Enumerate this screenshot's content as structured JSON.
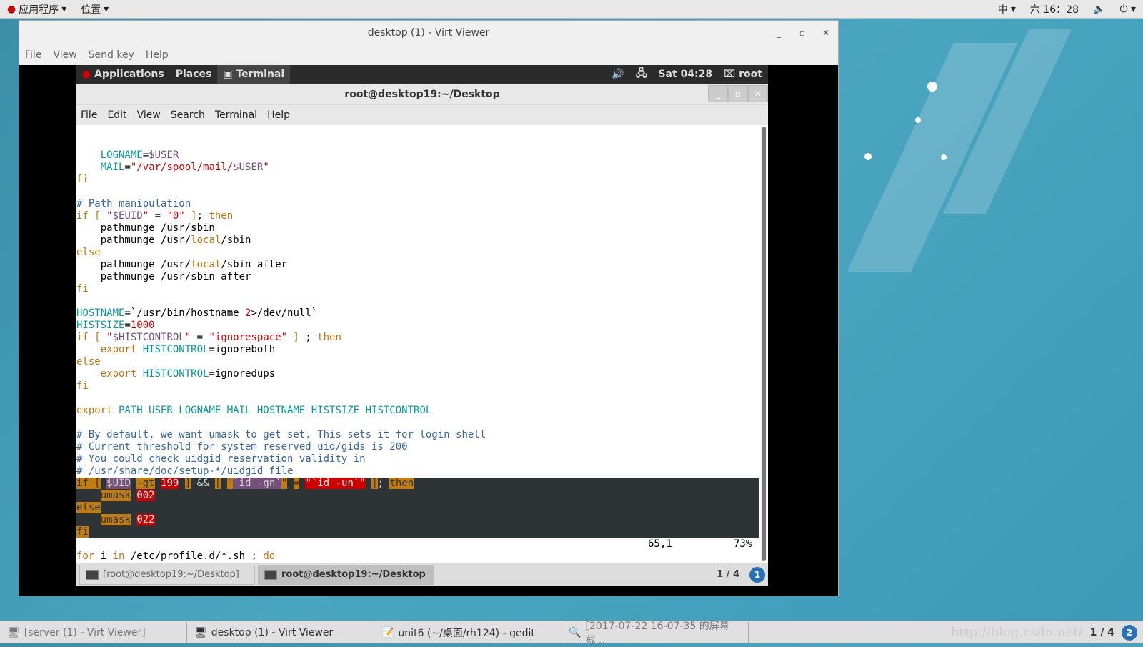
{
  "topbar": {
    "apps": "应用程序",
    "places": "位置",
    "input": "中",
    "clock": "六 16：28"
  },
  "viewer": {
    "title": "desktop (1) - Virt Viewer",
    "menu": [
      "File",
      "View",
      "Send key",
      "Help"
    ]
  },
  "guest_bar": {
    "applications": "Applications",
    "places": "Places",
    "terminal": "Terminal",
    "clock": "Sat 04:28",
    "user": "root"
  },
  "terminal": {
    "title": "root@desktop19:~/Desktop",
    "menu": [
      "File",
      "Edit",
      "View",
      "Search",
      "Terminal",
      "Help"
    ],
    "status_pos": "65,1",
    "status_pct": "73%",
    "lines": [
      {
        "s": [
          [
            "    ",
            ""
          ],
          [
            "LOGNAME",
            "c-cyan"
          ],
          [
            "=",
            ""
          ],
          [
            "$USER",
            "c-purple"
          ]
        ]
      },
      {
        "s": [
          [
            "    ",
            ""
          ],
          [
            "MAIL",
            "c-cyan"
          ],
          [
            "=",
            ""
          ],
          [
            "\"/var/spool/mail/",
            "c-red"
          ],
          [
            "$USER",
            "c-purple"
          ],
          [
            "\"",
            "c-red"
          ]
        ]
      },
      {
        "s": [
          [
            "fi",
            "c-orange"
          ]
        ]
      },
      {
        "s": []
      },
      {
        "s": [
          [
            "# Path manipulation",
            "c-blue"
          ]
        ]
      },
      {
        "s": [
          [
            "if [ ",
            "c-orange"
          ],
          [
            "\"",
            "c-red"
          ],
          [
            "$EUID",
            "c-purple"
          ],
          [
            "\"",
            "c-red"
          ],
          [
            " = ",
            ""
          ],
          [
            "\"0\"",
            "c-red"
          ],
          [
            " ]",
            "c-orange"
          ],
          [
            "; ",
            ""
          ],
          [
            "then",
            "c-orange"
          ]
        ]
      },
      {
        "s": [
          [
            "    pathmunge /usr/sbin",
            ""
          ]
        ]
      },
      {
        "s": [
          [
            "    pathmunge /usr/",
            ""
          ],
          [
            "local",
            "c-orange"
          ],
          [
            "/sbin",
            ""
          ]
        ]
      },
      {
        "s": [
          [
            "else",
            "c-orange"
          ]
        ]
      },
      {
        "s": [
          [
            "    pathmunge /usr/",
            ""
          ],
          [
            "local",
            "c-orange"
          ],
          [
            "/sbin after",
            ""
          ]
        ]
      },
      {
        "s": [
          [
            "    pathmunge /usr/sbin after",
            ""
          ]
        ]
      },
      {
        "s": [
          [
            "fi",
            "c-orange"
          ]
        ]
      },
      {
        "s": []
      },
      {
        "s": [
          [
            "HOSTNAME",
            "c-cyan"
          ],
          [
            "=`/usr/bin/hostname ",
            ""
          ],
          [
            "2",
            "c-red"
          ],
          [
            ">/dev/null`",
            ""
          ]
        ]
      },
      {
        "s": [
          [
            "HISTSIZE",
            "c-cyan"
          ],
          [
            "=",
            ""
          ],
          [
            "1000",
            "c-red"
          ]
        ]
      },
      {
        "s": [
          [
            "if [ ",
            "c-orange"
          ],
          [
            "\"",
            "c-red"
          ],
          [
            "$HISTCONTROL",
            "c-purple"
          ],
          [
            "\"",
            "c-red"
          ],
          [
            " = ",
            ""
          ],
          [
            "\"ignorespace\"",
            "c-red"
          ],
          [
            " ]",
            "c-orange"
          ],
          [
            " ; ",
            ""
          ],
          [
            "then",
            "c-orange"
          ]
        ]
      },
      {
        "s": [
          [
            "    ",
            ""
          ],
          [
            "export",
            "c-orange"
          ],
          [
            " ",
            ""
          ],
          [
            "HISTCONTROL",
            "c-cyan"
          ],
          [
            "=ignoreboth",
            ""
          ]
        ]
      },
      {
        "s": [
          [
            "else",
            "c-orange"
          ]
        ]
      },
      {
        "s": [
          [
            "    ",
            ""
          ],
          [
            "export",
            "c-orange"
          ],
          [
            " ",
            ""
          ],
          [
            "HISTCONTROL",
            "c-cyan"
          ],
          [
            "=ignoredups",
            ""
          ]
        ]
      },
      {
        "s": [
          [
            "fi",
            "c-orange"
          ]
        ]
      },
      {
        "s": []
      },
      {
        "s": [
          [
            "export",
            "c-orange"
          ],
          [
            " PATH USER LOGNAME MAIL HOSTNAME HISTSIZE HISTCONTROL",
            "c-cyan"
          ]
        ]
      },
      {
        "s": []
      },
      {
        "s": [
          [
            "# By default, we want umask to get set. This sets it for login shell",
            "c-blue"
          ]
        ]
      },
      {
        "s": [
          [
            "# Current threshold for system reserved uid/gids is 200",
            "c-blue"
          ]
        ]
      },
      {
        "s": [
          [
            "# You could check uidgid reservation validity in",
            "c-blue"
          ]
        ]
      },
      {
        "s": [
          [
            "# /usr/share/doc/setup-*/uidgid file",
            "c-blue"
          ]
        ]
      },
      {
        "hl": true,
        "s": [
          [
            "if [",
            "h-or"
          ],
          [
            " ",
            "h-plain"
          ],
          [
            "$UID",
            "h-pu"
          ],
          [
            " ",
            "h-plain"
          ],
          [
            "-gt",
            "h-or"
          ],
          [
            " ",
            "h-plain"
          ],
          [
            "199",
            "h-red"
          ],
          [
            " ",
            "h-plain"
          ],
          [
            "]",
            "h-or"
          ],
          [
            " && ",
            "h-plain"
          ],
          [
            "[",
            "h-or"
          ],
          [
            " ",
            "h-plain"
          ],
          [
            "\"",
            "h-or"
          ],
          [
            "`id -gn`",
            "h-pu"
          ],
          [
            "\"",
            "h-or"
          ],
          [
            " ",
            "h-plain"
          ],
          [
            "=",
            "h-or"
          ],
          [
            " ",
            "h-plain"
          ],
          [
            "\"`id -un`\"",
            "h-red"
          ],
          [
            " ",
            "h-plain"
          ],
          [
            "]",
            "h-or"
          ],
          [
            "; ",
            "h-plain"
          ],
          [
            "then",
            "h-or"
          ]
        ]
      },
      {
        "hl": true,
        "s": [
          [
            "    ",
            "h-plain"
          ],
          [
            "umask",
            "h-or"
          ],
          [
            " ",
            "h-plain"
          ],
          [
            "002",
            "h-red"
          ]
        ]
      },
      {
        "hl": true,
        "s": [
          [
            "else",
            "h-or"
          ]
        ]
      },
      {
        "hl": true,
        "s": [
          [
            "    ",
            "h-plain"
          ],
          [
            "umask",
            "h-or"
          ],
          [
            " ",
            "h-plain"
          ],
          [
            "022",
            "h-red"
          ]
        ]
      },
      {
        "hl": true,
        "s": [
          [
            "fi",
            "h-or"
          ]
        ]
      },
      {
        "s": []
      },
      {
        "s": [
          [
            "for",
            "c-orange"
          ],
          [
            " i ",
            ""
          ],
          [
            "in",
            "c-orange"
          ],
          [
            " /etc/profile.d/*.sh ; ",
            ""
          ],
          [
            "do",
            "c-orange"
          ]
        ]
      }
    ]
  },
  "guest_tasks": [
    "[root@desktop19:~/Desktop]",
    "root@desktop19:~/Desktop"
  ],
  "guest_pager": "1 / 4",
  "guest_badge": "1",
  "taskbar": {
    "items": [
      "[server (1) - Virt Viewer]",
      "desktop (1) - Virt Viewer",
      "unit6 (~/桌面/rh124) - gedit",
      "[2017-07-22 16-07-35 的屏幕截..."
    ],
    "pager": "1 / 4",
    "badge": "2",
    "watermark": "http://blog.csdn.net/"
  }
}
